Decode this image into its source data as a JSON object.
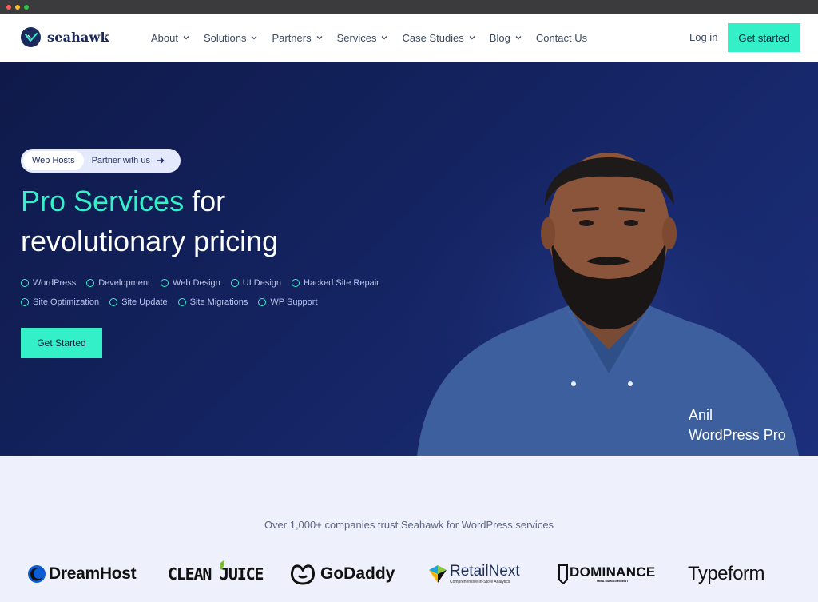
{
  "brand": {
    "name": "seahawk"
  },
  "nav": {
    "items": [
      {
        "label": "About",
        "has_dropdown": true
      },
      {
        "label": "Solutions",
        "has_dropdown": true
      },
      {
        "label": "Partners",
        "has_dropdown": true
      },
      {
        "label": "Services",
        "has_dropdown": true
      },
      {
        "label": "Case Studies",
        "has_dropdown": true
      },
      {
        "label": "Blog",
        "has_dropdown": true
      },
      {
        "label": "Contact Us",
        "has_dropdown": false
      }
    ],
    "login": "Log in",
    "cta": "Get started"
  },
  "hero": {
    "pill_tag": "Web Hosts",
    "pill_link": "Partner with us",
    "title_accent": "Pro Services",
    "title_rest_line1": " for",
    "title_line2": "revolutionary pricing",
    "features_row1": [
      "WordPress",
      "Development",
      "Web Design",
      "UI Design",
      "Hacked Site Repair"
    ],
    "features_row2": [
      "Site Optimization",
      "Site Update",
      "Site Migrations",
      "WP Support"
    ],
    "cta": "Get Started",
    "person_name": "Anil",
    "person_role": "WordPress Pro"
  },
  "trust": {
    "text": "Over 1,000+ companies trust Seahawk for WordPress services",
    "logos": [
      {
        "name": "DreamHost",
        "icon": "moon-circle-icon"
      },
      {
        "name": "CLEAN JUICE",
        "icon": "leaf-icon"
      },
      {
        "name": "GoDaddy",
        "icon": "godaddy-icon"
      },
      {
        "name": "RetailNext",
        "sub": "Comprehensive In-Store Analytics",
        "icon": "retailnext-icon"
      },
      {
        "name": "DOMINANCE",
        "sub": "MMA MANAGEMENT",
        "icon": "shield-icon"
      },
      {
        "name": "Typeform",
        "icon": ""
      }
    ]
  },
  "colors": {
    "accent": "#34f0c8",
    "navy": "#1b2a5c",
    "hero_bg": "#152565"
  }
}
